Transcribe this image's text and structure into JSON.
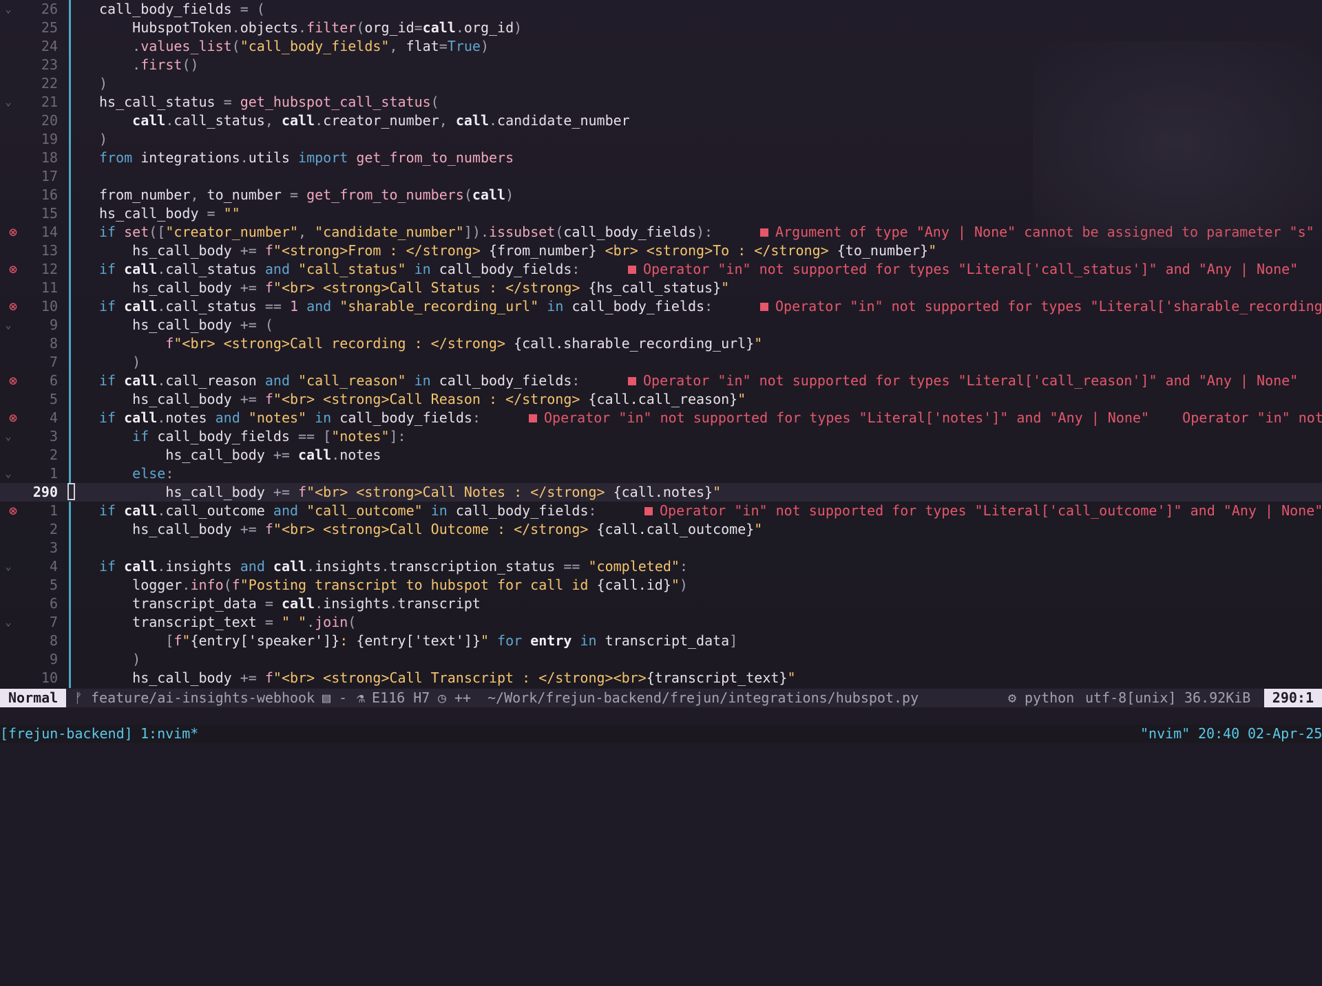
{
  "editor": {
    "current_line_number": "290",
    "lines": [
      {
        "rel": "26",
        "fold": "v",
        "code": "call_body_fields = ("
      },
      {
        "rel": "25",
        "code": "    HubspotToken.objects.filter(org_id=call.org_id)"
      },
      {
        "rel": "24",
        "code": "    .values_list(\"call_body_fields\", flat=True)"
      },
      {
        "rel": "23",
        "code": "    .first()"
      },
      {
        "rel": "22",
        "code": ")"
      },
      {
        "rel": "21",
        "fold": "v",
        "code": "hs_call_status = get_hubspot_call_status("
      },
      {
        "rel": "20",
        "code": "    call.call_status, call.creator_number, call.candidate_number"
      },
      {
        "rel": "19",
        "code": ")"
      },
      {
        "rel": "18",
        "code": "from integrations.utils import get_from_to_numbers"
      },
      {
        "rel": "17",
        "code": ""
      },
      {
        "rel": "16",
        "code": "from_number, to_number = get_from_to_numbers(call)"
      },
      {
        "rel": "15",
        "code": "hs_call_body = \"\""
      },
      {
        "rel": "14",
        "diag": true,
        "code": "if set([\"creator_number\", \"candidate_number\"]).issubset(call_body_fields):",
        "vt": "Argument of type \"Any | None\" cannot be assigned to parameter \"s\" o"
      },
      {
        "rel": "13",
        "code": "    hs_call_body += f\"<strong>From : </strong> {from_number} <br> <strong>To : </strong> {to_number}\""
      },
      {
        "rel": "12",
        "diag": true,
        "code": "if call.call_status and \"call_status\" in call_body_fields:",
        "vt": "Operator \"in\" not supported for types \"Literal['call_status']\" and \"Any | None\""
      },
      {
        "rel": "11",
        "code": "    hs_call_body += f\"<br> <strong>Call Status : </strong> {hs_call_status}\""
      },
      {
        "rel": "10",
        "diag": true,
        "code": "if call.call_status == 1 and \"sharable_recording_url\" in call_body_fields:",
        "vt": "Operator \"in\" not supported for types \"Literal['sharable_recording_"
      },
      {
        "rel": "9",
        "fold": "v",
        "code": "    hs_call_body += ("
      },
      {
        "rel": "8",
        "code": "        f\"<br> <strong>Call recording : </strong> {call.sharable_recording_url}\""
      },
      {
        "rel": "7",
        "code": "    )"
      },
      {
        "rel": "6",
        "diag": true,
        "code": "if call.call_reason and \"call_reason\" in call_body_fields:",
        "vt": "Operator \"in\" not supported for types \"Literal['call_reason']\" and \"Any | None\""
      },
      {
        "rel": "5",
        "code": "    hs_call_body += f\"<br> <strong>Call Reason : </strong> {call.call_reason}\""
      },
      {
        "rel": "4",
        "diag": true,
        "code": "if call.notes and \"notes\" in call_body_fields:",
        "vt": "Operator \"in\" not supported for types \"Literal['notes']\" and \"Any | None\"    Operator \"in\" not"
      },
      {
        "rel": "3",
        "fold": "v",
        "code": "    if call_body_fields == [\"notes\"]:"
      },
      {
        "rel": "2",
        "code": "        hs_call_body += call.notes"
      },
      {
        "rel": "1",
        "fold": "v",
        "code": "    else:"
      },
      {
        "rel": "290",
        "cur": true,
        "code": "        hs_call_body += f\"<br> <strong>Call Notes : </strong> {call.notes}\""
      },
      {
        "rel": "1",
        "diag": true,
        "code": "if call.call_outcome and \"call_outcome\" in call_body_fields:",
        "vt": "Operator \"in\" not supported for types \"Literal['call_outcome']\" and \"Any | None\""
      },
      {
        "rel": "2",
        "code": "    hs_call_body += f\"<br> <strong>Call Outcome : </strong> {call.call_outcome}\""
      },
      {
        "rel": "3",
        "code": ""
      },
      {
        "rel": "4",
        "fold": "v",
        "code": "if call.insights and call.insights.transcription_status == \"completed\":"
      },
      {
        "rel": "5",
        "code": "    logger.info(f\"Posting transcript to hubspot for call id {call.id}\")"
      },
      {
        "rel": "6",
        "code": "    transcript_data = call.insights.transcript"
      },
      {
        "rel": "7",
        "fold": "v",
        "code": "    transcript_text = \" \".join("
      },
      {
        "rel": "8",
        "code": "        [f\"{entry['speaker']}: {entry['text']}\" for entry in transcript_data]"
      },
      {
        "rel": "9",
        "code": "    )"
      },
      {
        "rel": "10",
        "code": "    hs_call_body += f\"<br> <strong>Call Transcript : </strong><br>{transcript_text}\""
      }
    ]
  },
  "statusline": {
    "mode": "Normal",
    "branch": "feature/ai-insights-webhook",
    "file_flag": "-",
    "diagnostics": "E116 H7",
    "changes": "++",
    "path": "~/Work/frejun-backend/frejun/integrations/hubspot.py",
    "filetype": "python",
    "encoding": "utf-8[unix]",
    "filesize": "36.92KiB",
    "position": "290:1"
  },
  "tmux": {
    "session": "[frejun-backend]",
    "window": "1:nvim*",
    "title": "\"nvim\"",
    "time": "20:40",
    "date": "02-Apr-25"
  },
  "colors": {
    "background": "#1f1b26",
    "keyword": "#5fa6cf",
    "function": "#f0a8bd",
    "string": "#f5c46e",
    "error": "#e5576a",
    "separator": "#54c2e0"
  }
}
